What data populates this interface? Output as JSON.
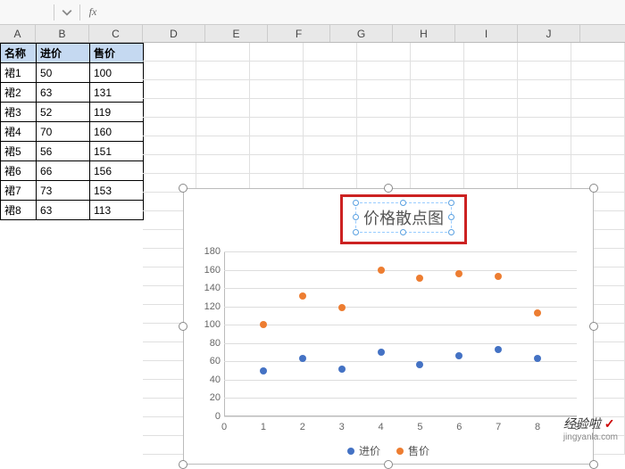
{
  "formula_bar": {
    "fx": "fx"
  },
  "columns": [
    "A",
    "B",
    "C",
    "D",
    "E",
    "F",
    "G",
    "H",
    "I",
    "J"
  ],
  "table": {
    "headers": {
      "name": "名称",
      "cost": "进价",
      "price": "售价"
    },
    "rows": [
      {
        "name": "裙1",
        "cost": "50",
        "price": "100"
      },
      {
        "name": "裙2",
        "cost": "63",
        "price": "131"
      },
      {
        "name": "裙3",
        "cost": "52",
        "price": "119"
      },
      {
        "name": "裙4",
        "cost": "70",
        "price": "160"
      },
      {
        "name": "裙5",
        "cost": "56",
        "price": "151"
      },
      {
        "name": "裙6",
        "cost": "66",
        "price": "156"
      },
      {
        "name": "裙7",
        "cost": "73",
        "price": "153"
      },
      {
        "name": "裙8",
        "cost": "63",
        "price": "113"
      }
    ]
  },
  "chart_data": {
    "type": "scatter",
    "title": "价格散点图",
    "xlabel": "",
    "ylabel": "",
    "xlim": [
      0,
      9
    ],
    "ylim": [
      0,
      180
    ],
    "y_ticks": [
      0,
      20,
      40,
      60,
      80,
      100,
      120,
      140,
      160,
      180
    ],
    "x_ticks": [
      0,
      1,
      2,
      3,
      4,
      5,
      6,
      7,
      8,
      9
    ],
    "x": [
      1,
      2,
      3,
      4,
      5,
      6,
      7,
      8
    ],
    "series": [
      {
        "name": "进价",
        "color": "#4472c4",
        "values": [
          50,
          63,
          52,
          70,
          56,
          66,
          73,
          63
        ]
      },
      {
        "name": "售价",
        "color": "#ed7d31",
        "values": [
          100,
          131,
          119,
          160,
          151,
          156,
          153,
          113
        ]
      }
    ],
    "legend_position": "bottom",
    "grid": true
  },
  "watermark": {
    "brand": "经验啦",
    "check": "✓",
    "url": "jingyanla.com"
  }
}
